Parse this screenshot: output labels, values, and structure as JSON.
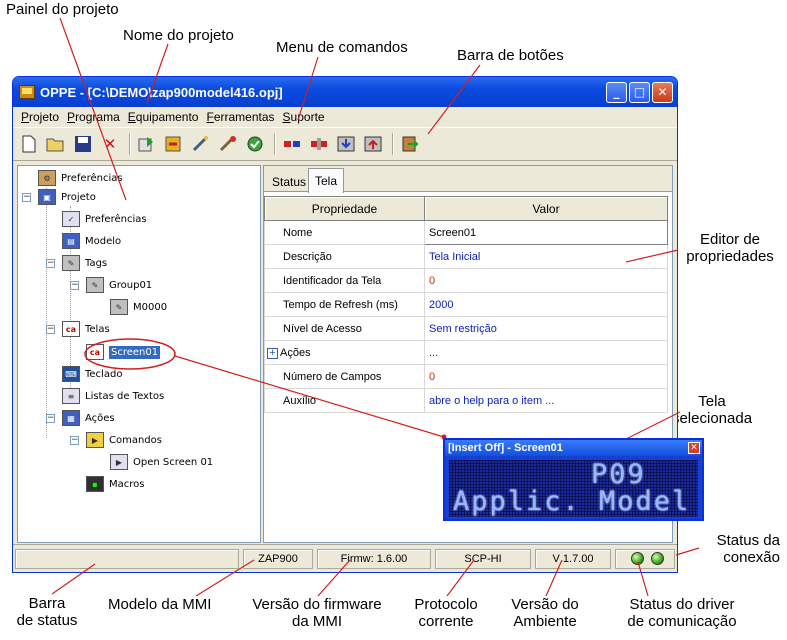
{
  "annotations": {
    "painel": "Painel do projeto",
    "nome": "Nome do projeto",
    "menu": "Menu de comandos",
    "barra_botoes": "Barra de botões",
    "editor_l1": "Editor de",
    "editor_l2": "propriedades",
    "tela_sel_l1": "Tela",
    "tela_sel_l2": "selecionada",
    "status_conexao_l1": "Status da",
    "status_conexao_l2": "conexão",
    "barra_status_l1": "Barra",
    "barra_status_l2": "de status",
    "modelo_mmi": "Modelo da MMI",
    "versao_fw_l1": "Versão do firmware",
    "versao_fw_l2": "da MMI",
    "protocolo_l1": "Protocolo",
    "protocolo_l2": "corrente",
    "versao_amb_l1": "Versão do",
    "versao_amb_l2": "Ambiente",
    "status_driver_l1": "Status do driver",
    "status_driver_l2": "de comunicação"
  },
  "window": {
    "title": "OPPE - [C:\\DEMO\\zap900model416.opj]",
    "minimize": "_",
    "maximize": "□",
    "close": "✕"
  },
  "menu": [
    "Projeto",
    "Programa",
    "Equipamento",
    "Ferramentas",
    "Suporte"
  ],
  "toolbar": {
    "icons": [
      "new-icon",
      "open-icon",
      "save-icon",
      "delete-icon",
      "import-icon",
      "export-icon",
      "tools-icon",
      "compile-icon",
      "check-icon",
      "connect-icon",
      "disconnect-icon",
      "download-icon",
      "upload-icon",
      "exit-icon"
    ]
  },
  "tree": {
    "preferencias_root": "Preferências",
    "projeto": "Projeto",
    "preferencias": "Preferências",
    "modelo": "Modelo",
    "tags": "Tags",
    "group01": "Group01",
    "m0000": "M0000",
    "telas": "Telas",
    "screen01": "Screen01",
    "teclado": "Teclado",
    "listas": "Listas de Textos",
    "acoes": "Ações",
    "comandos": "Comandos",
    "open_screen": "Open Screen 01",
    "macros": "Macros"
  },
  "tabs": {
    "status": "Status",
    "tela": "Tela"
  },
  "properties": {
    "col_prop": "Propriedade",
    "col_val": "Valor",
    "rows": [
      {
        "name": "Nome",
        "value": "Screen01"
      },
      {
        "name": "Descrição",
        "value": "Tela Inicial"
      },
      {
        "name": "Identificador da Tela",
        "value": "0"
      },
      {
        "name": "Tempo de Refresh (ms)",
        "value": "2000"
      },
      {
        "name": "Nível de Acesso",
        "value": "Sem restrição"
      },
      {
        "name": "Ações",
        "value": "..."
      },
      {
        "name": "Número de Campos",
        "value": "0"
      },
      {
        "name": "Auxílio",
        "value": "abre o help para o item ..."
      }
    ]
  },
  "status": {
    "model": "ZAP900",
    "firmware": "Firmw: 1.6.00",
    "protocol": "SCP-HI",
    "version": "V 1.7.00"
  },
  "lcd": {
    "title": "[Insert Off] - Screen01",
    "close": "✕",
    "line1": "P09",
    "line2": "Applic. Model"
  }
}
